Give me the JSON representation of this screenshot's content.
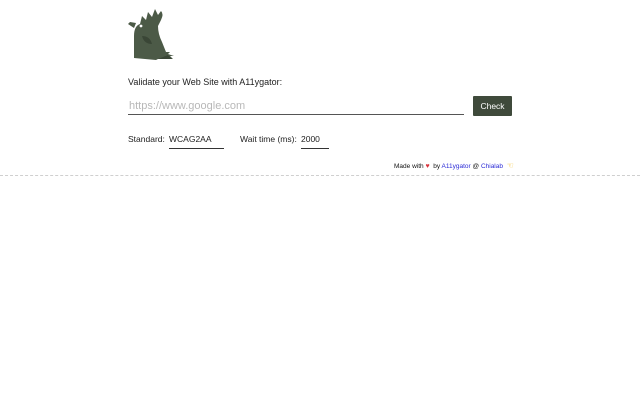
{
  "form": {
    "prompt": "Validate your Web Site with A11ygator:",
    "url_placeholder": "https://www.google.com",
    "url_value": "",
    "check_label": "Check",
    "standard_label": "Standard:",
    "standard_value": "WCAG2AA",
    "wait_label": "Wait time (ms):",
    "wait_value": "2000"
  },
  "footer": {
    "made_with": "Made with",
    "heart_icon": "heart-icon",
    "by": "by",
    "project_link": "A11ygator",
    "at": "@",
    "company_link": "Chialab",
    "hand_icon": "pointing-hand-icon"
  },
  "colors": {
    "button_bg": "#3f4a3b",
    "logo_green": "#4c5a47",
    "link": "#2b2bd6",
    "heart": "#d8343c"
  }
}
